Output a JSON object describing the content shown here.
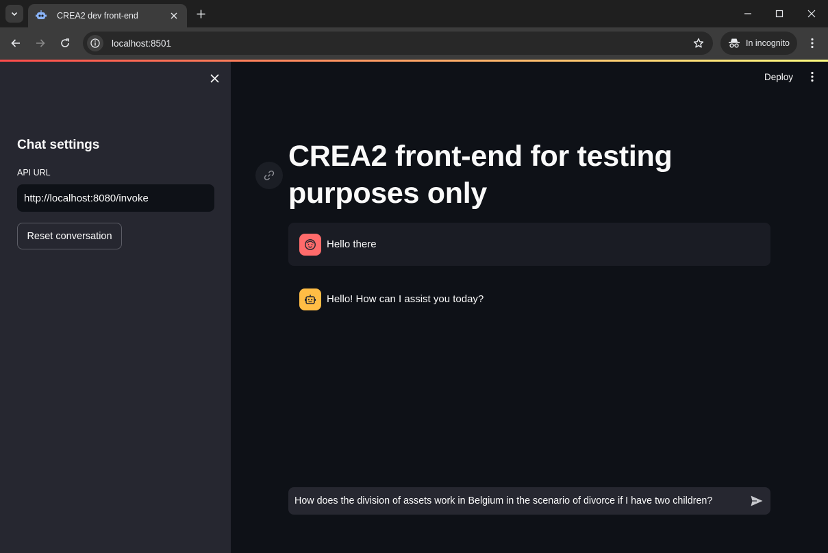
{
  "browser": {
    "tab_title": "CREA2 dev front-end",
    "url": "localhost:8501",
    "incognito_label": "In incognito"
  },
  "sidebar": {
    "heading": "Chat settings",
    "api_label": "API URL",
    "api_value": "http://localhost:8080/invoke",
    "reset_label": "Reset conversation"
  },
  "header": {
    "deploy_label": "Deploy"
  },
  "main": {
    "title": "CREA2 front-end for testing purposes only",
    "messages": [
      {
        "role": "user",
        "text": "Hello there"
      },
      {
        "role": "assistant",
        "text": "Hello! How can I assist you today?"
      }
    ],
    "chat_input_value": "How does the division of assets work in Belgium in the scenario of divorce if I have two children?"
  },
  "colors": {
    "accent_red": "#ff4b4b",
    "user_avatar": "#ff6b6b",
    "bot_avatar": "#ffbd45",
    "sidebar_bg": "#262730",
    "app_bg": "#0e1117"
  },
  "icons": [
    "tab-search-icon",
    "favicon-robot-icon",
    "close-icon",
    "plus-icon",
    "minimize-icon",
    "maximize-icon",
    "back-arrow-icon",
    "forward-arrow-icon",
    "reload-icon",
    "info-icon",
    "star-icon",
    "incognito-icon",
    "kebab-menu-icon",
    "link-icon",
    "user-face-icon",
    "robot-icon",
    "send-icon"
  ]
}
